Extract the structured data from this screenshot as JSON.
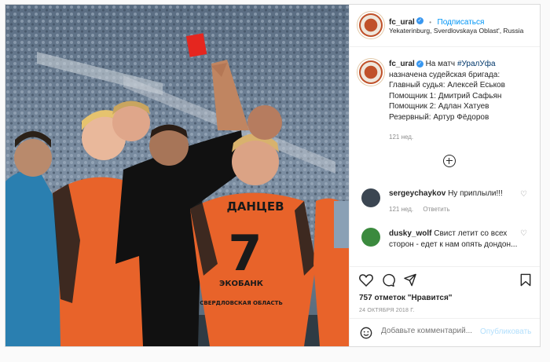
{
  "header": {
    "username": "fc_ural",
    "verified_mark": "✓",
    "follow_label": "Подписаться",
    "separator": "•",
    "location": "Yekaterinburg, Sverdlovskaya Oblast', Russia"
  },
  "caption": {
    "username": "fc_ural",
    "verified_mark": "✓",
    "intro": "На матч ",
    "hashtag": "#УралУфа",
    "lines": [
      "назначена судейская бригада:",
      "Главный судья: Алексей Еськов",
      "Помощник 1: Дмитрий Сафьян",
      "Помощник 2: Адлан Хатуев",
      "Резервный: Артур Фёдоров"
    ],
    "age": "121 нед."
  },
  "comments": [
    {
      "username": "sergeychaykov",
      "text": "Ну приплыли!!!",
      "time": "121 нед.",
      "reply_label": "Ответить"
    },
    {
      "username": "dusky_wolf",
      "text": "Свист летит со всех сторон - едет к нам опять дондон...",
      "time": "",
      "reply_label": ""
    }
  ],
  "photo": {
    "shirt_name": "ДАНЦЕВ",
    "shirt_number": "7",
    "sponsor": "ЭКОБАНК",
    "sponsor_sub": "СВЕРДЛОВСКАЯ ОБЛАСТЬ"
  },
  "actions": {
    "likes": "757 отметок \"Нравится\"",
    "date": "24 ОКТЯБРЯ 2018 Г.",
    "add_comment_placeholder": "Добавьте комментарий...",
    "publish_label": "Опубликовать"
  },
  "icons": [
    "heart-icon",
    "comment-icon",
    "share-icon",
    "bookmark-icon",
    "emoji-icon",
    "load-more-icon"
  ],
  "colors": {
    "link": "#0095f6",
    "publish_disabled": "#b2dffc",
    "muted": "#8e8e8e",
    "kit_orange": "#e8632a"
  }
}
